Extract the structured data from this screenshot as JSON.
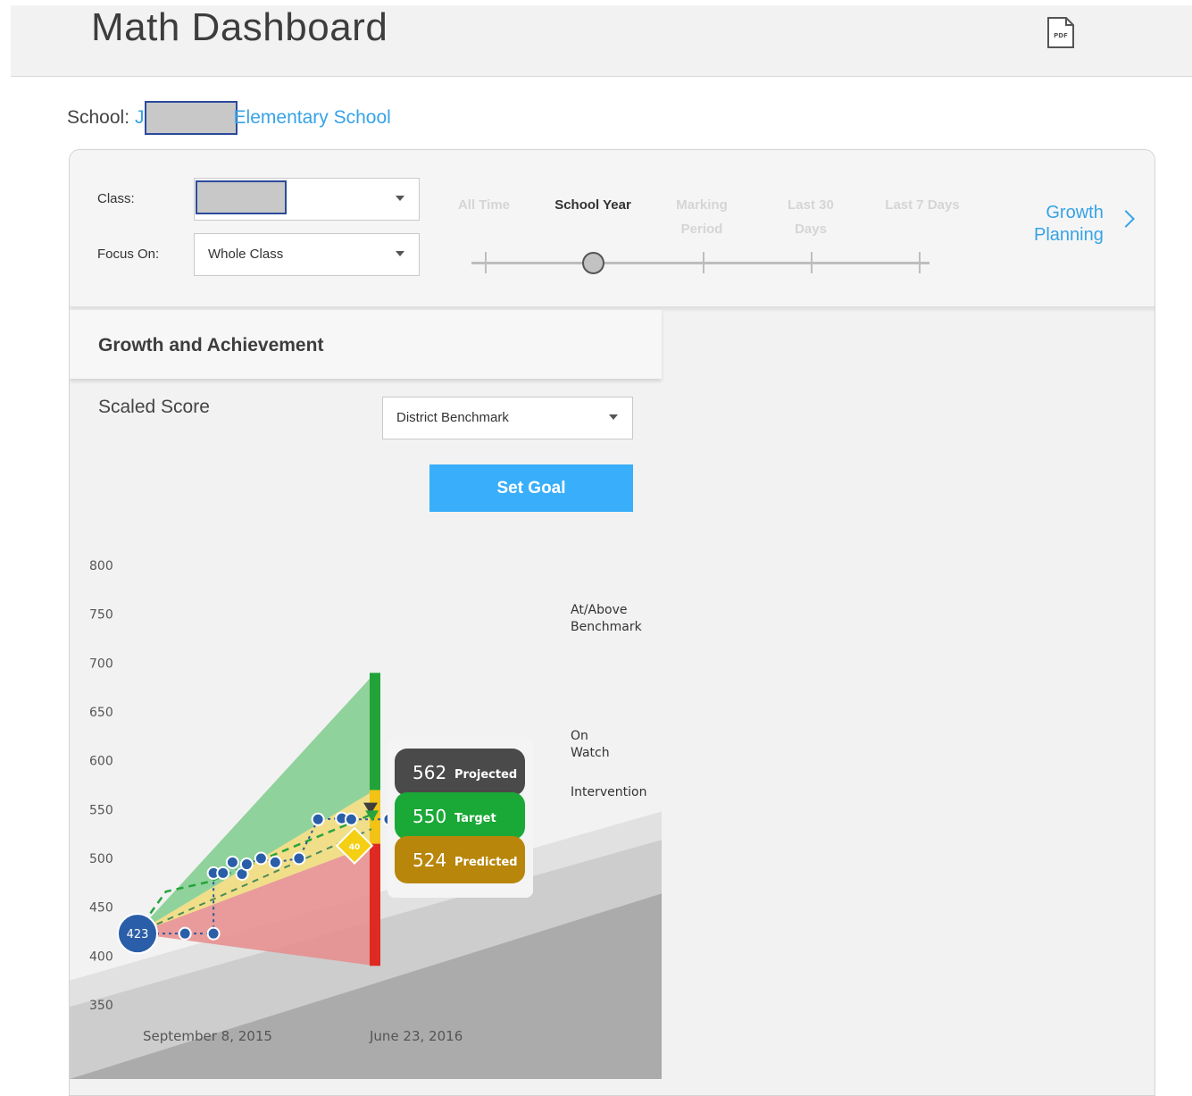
{
  "header": {
    "title": "Math Dashboard",
    "pdf_icon": "pdf-file-icon",
    "pdf_label": "PDF"
  },
  "school": {
    "label": "School:",
    "name_prefix": "J",
    "name": "Elementary School"
  },
  "filters": {
    "class_label": "Class:",
    "class_value": "",
    "focus_label": "Focus On:",
    "focus_value": "Whole Class",
    "periods": [
      "All Time",
      "School Year",
      "Marking Period",
      "Last 30 Days",
      "Last 7 Days"
    ],
    "selected_period": "School Year"
  },
  "growth_planning": {
    "line1": "Growth",
    "line2": "Planning"
  },
  "panel": {
    "title": "Growth and Achievement",
    "metric_label": "Scaled Score",
    "benchmark_select": "District Benchmark",
    "set_goal_label": "Set Goal"
  },
  "chart_data": {
    "type": "line",
    "y_ticks": [
      800,
      750,
      700,
      650,
      600,
      550,
      500,
      450,
      400,
      350
    ],
    "ylim": [
      340,
      820
    ],
    "x_labels": [
      "September 8, 2015",
      "June 23, 2016"
    ],
    "start_score": 423,
    "bands": [
      "At/Above Benchmark",
      "On Watch",
      "Intervention"
    ],
    "goal_marker": "40",
    "scores": [
      {
        "x": 0.0,
        "y": 423
      },
      {
        "x": 0.2,
        "y": 423
      },
      {
        "x": 0.32,
        "y": 423
      },
      {
        "x": 0.32,
        "y": 485
      },
      {
        "x": 0.36,
        "y": 485
      },
      {
        "x": 0.4,
        "y": 496
      },
      {
        "x": 0.44,
        "y": 484
      },
      {
        "x": 0.46,
        "y": 494
      },
      {
        "x": 0.52,
        "y": 500
      },
      {
        "x": 0.58,
        "y": 496
      },
      {
        "x": 0.68,
        "y": 500
      },
      {
        "x": 0.76,
        "y": 540
      },
      {
        "x": 0.86,
        "y": 541
      },
      {
        "x": 0.9,
        "y": 540
      },
      {
        "x": 1.06,
        "y": 540
      }
    ],
    "legend": [
      {
        "value": "562",
        "label": "Projected",
        "color": "#4a4a4a"
      },
      {
        "value": "550",
        "label": "Target",
        "color": "#1aa836"
      },
      {
        "value": "524",
        "label": "Predicted",
        "color": "#b8860b"
      }
    ]
  }
}
